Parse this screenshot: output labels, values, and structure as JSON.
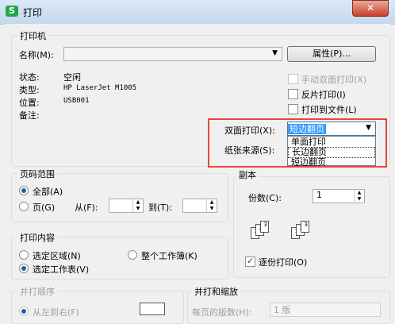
{
  "window": {
    "icon_text": "S",
    "title": "打印",
    "close": "✕"
  },
  "printer": {
    "group_label": "打印机",
    "name_label": "名称(M):",
    "name_value": "",
    "properties_button": "属性(P)...",
    "status_label": "状态:",
    "status_value": "空闲",
    "type_label": "类型:",
    "type_value": "HP LaserJet M1005",
    "location_label": "位置:",
    "location_value": "USB001",
    "comment_label": "备注:",
    "manual_duplex": "手动双面打印(X)",
    "reverse_print": "反片打印(I)",
    "print_to_file": "打印到文件(L)"
  },
  "duplex": {
    "label": "双面打印(X):",
    "selected": "短边翻页",
    "options": [
      "单面打印",
      "长边翻页",
      "短边翻页"
    ],
    "highlighted_index": 1
  },
  "paper_source": {
    "label": "纸张来源(S):"
  },
  "page_range": {
    "group_label": "页码范围",
    "all": "全部(A)",
    "pages": "页(G)",
    "from_label": "从(F):",
    "to_label": "到(T):"
  },
  "copies": {
    "group_label": "副本",
    "count_label": "份数(C):",
    "count_value": "1",
    "collate": "逐份打印(O)"
  },
  "print_content": {
    "group_label": "打印内容",
    "selection": "选定区域(N)",
    "workbook": "整个工作簿(K)",
    "active_sheet": "选定工作表(V)"
  },
  "print_order": {
    "group_label": "并打顺序",
    "left_to_right": "从左到右(F)"
  },
  "scaling": {
    "group_label": "并打和缩放",
    "pages_per_sheet_label": "每页的版数(H):",
    "pages_per_sheet_value": "1 版"
  }
}
